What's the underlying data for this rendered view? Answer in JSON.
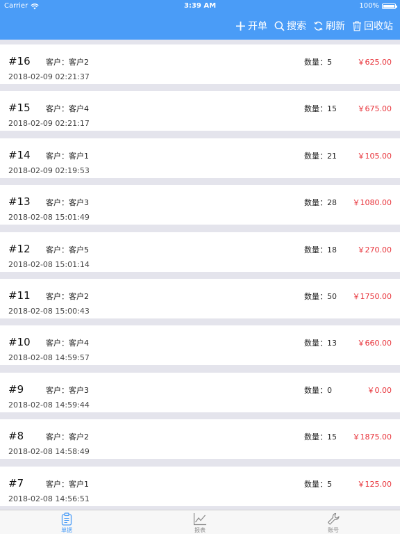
{
  "status_bar": {
    "carrier": "Carrier",
    "time": "3:39 AM",
    "battery": "100%"
  },
  "toolbar": {
    "new_label": "开单",
    "search_label": "搜索",
    "refresh_label": "刷新",
    "recycle_label": "回收站"
  },
  "orders": [
    {
      "num": "#16",
      "customer": "客户：客户2",
      "qty": "数量：5",
      "price": "￥625.00",
      "time": "2018-02-09 02:21:37"
    },
    {
      "num": "#15",
      "customer": "客户：客户4",
      "qty": "数量：15",
      "price": "￥675.00",
      "time": "2018-02-09 02:21:17"
    },
    {
      "num": "#14",
      "customer": "客户：客户1",
      "qty": "数量：21",
      "price": "￥105.00",
      "time": "2018-02-09 02:19:53"
    },
    {
      "num": "#13",
      "customer": "客户：客户3",
      "qty": "数量：28",
      "price": "￥1080.00",
      "time": "2018-02-08 15:01:49"
    },
    {
      "num": "#12",
      "customer": "客户：客户5",
      "qty": "数量：18",
      "price": "￥270.00",
      "time": "2018-02-08 15:01:14"
    },
    {
      "num": "#11",
      "customer": "客户：客户2",
      "qty": "数量：50",
      "price": "￥1750.00",
      "time": "2018-02-08 15:00:43"
    },
    {
      "num": "#10",
      "customer": "客户：客户4",
      "qty": "数量：13",
      "price": "￥660.00",
      "time": "2018-02-08 14:59:57"
    },
    {
      "num": "#9",
      "customer": "客户：客户3",
      "qty": "数量：0",
      "price": "￥0.00",
      "time": "2018-02-08 14:59:44"
    },
    {
      "num": "#8",
      "customer": "客户：客户2",
      "qty": "数量：15",
      "price": "￥1875.00",
      "time": "2018-02-08 14:58:49"
    },
    {
      "num": "#7",
      "customer": "客户：客户1",
      "qty": "数量：5",
      "price": "￥125.00",
      "time": "2018-02-08 14:56:51"
    }
  ],
  "tabs": [
    {
      "label": "单据",
      "icon": "clipboard-icon"
    },
    {
      "label": "报表",
      "icon": "chart-line-icon"
    },
    {
      "label": "账号",
      "icon": "wrench-icon"
    }
  ],
  "colors": {
    "accent": "#4a9cf7",
    "price": "#e8333a"
  }
}
